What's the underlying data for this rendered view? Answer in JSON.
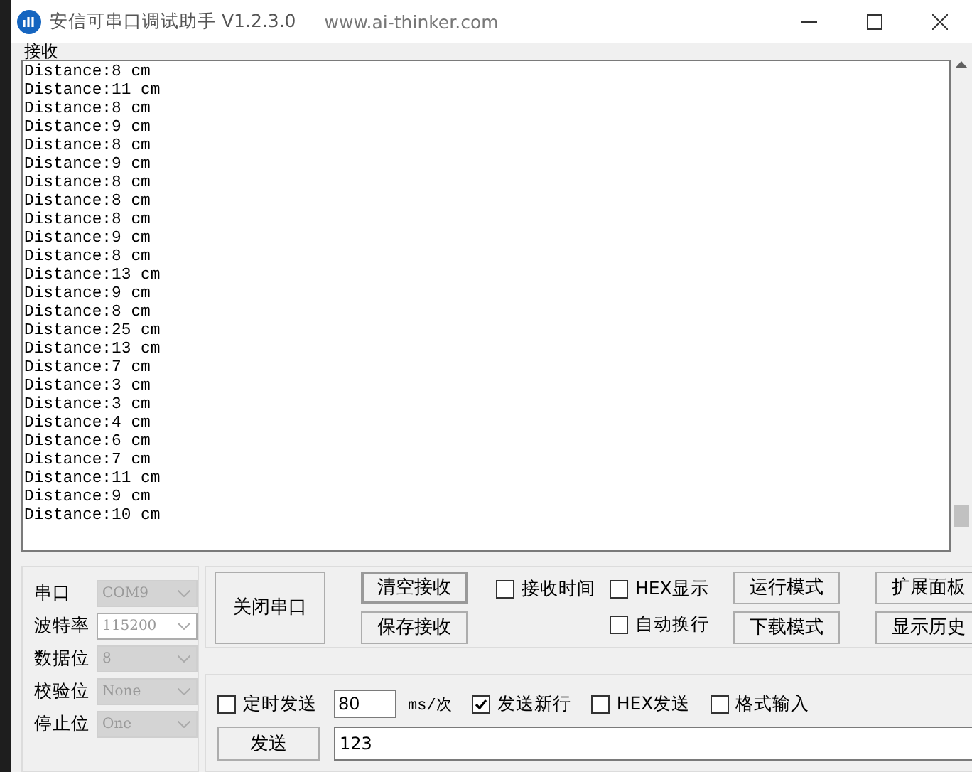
{
  "window": {
    "title": "安信可串口调试助手 V1.2.3.0",
    "url": "www.ai-thinker.com"
  },
  "receive": {
    "label": "接收",
    "lines": [
      "Distance:8 cm",
      "Distance:11 cm",
      "Distance:8 cm",
      "Distance:9 cm",
      "Distance:8 cm",
      "Distance:9 cm",
      "Distance:8 cm",
      "Distance:8 cm",
      "Distance:8 cm",
      "Distance:9 cm",
      "Distance:8 cm",
      "Distance:13 cm",
      "Distance:9 cm",
      "Distance:8 cm",
      "Distance:25 cm",
      "Distance:13 cm",
      "Distance:7 cm",
      "Distance:3 cm",
      "Distance:3 cm",
      "Distance:4 cm",
      "Distance:6 cm",
      "Distance:7 cm",
      "Distance:11 cm",
      "Distance:9 cm",
      "Distance:10 cm"
    ]
  },
  "port_settings": [
    {
      "label": "串口",
      "value": "COM9",
      "disabled": true
    },
    {
      "label": "波特率",
      "value": "115200",
      "disabled": false
    },
    {
      "label": "数据位",
      "value": "8",
      "disabled": true
    },
    {
      "label": "校验位",
      "value": "None",
      "disabled": true
    },
    {
      "label": "停止位",
      "value": "One",
      "disabled": true
    }
  ],
  "open_button": "关闭串口",
  "receive_buttons": [
    {
      "label": "清空接收",
      "focused": true
    },
    {
      "label": "保存接收",
      "focused": false
    }
  ],
  "receive_options": [
    {
      "label": "接收时间",
      "checked": false
    },
    {
      "label": "HEX显示",
      "checked": false
    },
    {
      "label": "自动换行",
      "checked": false
    }
  ],
  "mode_buttons": [
    "运行模式",
    "下载模式"
  ],
  "panel_buttons": [
    "扩展面板",
    "显示历史"
  ],
  "send": {
    "timed": {
      "label": "定时发送",
      "checked": false
    },
    "interval": "80",
    "unit": "ms/次",
    "options": [
      {
        "label": "发送新行",
        "checked": true
      },
      {
        "label": "HEX发送",
        "checked": false
      },
      {
        "label": "格式输入",
        "checked": false
      }
    ],
    "button": "发送",
    "text": "123"
  }
}
